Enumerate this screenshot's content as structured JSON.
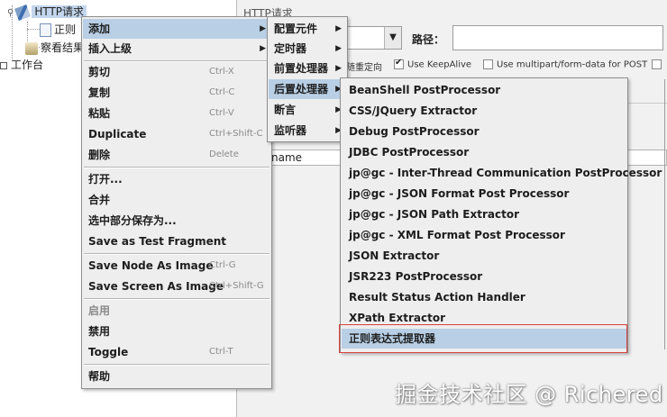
{
  "tree": {
    "http_request": "HTTP请求",
    "regex_node": "正则",
    "results_node": "察看结果",
    "workbench": "工作台"
  },
  "editor": {
    "title": "HTTP请求",
    "path_label": "路径：",
    "redirect_label": "随重定向",
    "keepalive_label": "Use KeepAlive",
    "multipart_label": "Use multipart/form-data for POST",
    "name_field": "name"
  },
  "main_menu": {
    "items": [
      {
        "label": "添加",
        "accel": "",
        "submenu": true
      },
      {
        "label": "插入上级",
        "accel": "",
        "submenu": true
      },
      {
        "label": "剪切",
        "accel": "Ctrl-X"
      },
      {
        "label": "复制",
        "accel": "Ctrl-C"
      },
      {
        "label": "粘贴",
        "accel": "Ctrl-V"
      },
      {
        "label": "Duplicate",
        "accel": "Ctrl+Shift-C"
      },
      {
        "label": "删除",
        "accel": "Delete"
      },
      {
        "label": "打开...",
        "accel": ""
      },
      {
        "label": "合并",
        "accel": ""
      },
      {
        "label": "选中部分保存为...",
        "accel": ""
      },
      {
        "label": "Save as Test Fragment",
        "accel": ""
      },
      {
        "label": "Save Node As Image",
        "accel": "Ctrl-G"
      },
      {
        "label": "Save Screen As Image",
        "accel": "Ctrl+Shift-G"
      },
      {
        "label": "启用",
        "accel": ""
      },
      {
        "label": "禁用",
        "accel": ""
      },
      {
        "label": "Toggle",
        "accel": "Ctrl-T"
      },
      {
        "label": "帮助",
        "accel": ""
      }
    ]
  },
  "add_menu": {
    "items": [
      "配置元件",
      "定时器",
      "前置处理器",
      "后置处理器",
      "断言",
      "监听器"
    ]
  },
  "post_menu": {
    "items": [
      "BeanShell PostProcessor",
      "CSS/JQuery Extractor",
      "Debug PostProcessor",
      "JDBC PostProcessor",
      "jp@gc - Inter-Thread Communication PostProcessor",
      "jp@gc - JSON Format Post Processor",
      "jp@gc - JSON Path Extractor",
      "jp@gc - XML Format Post Processor",
      "JSON Extractor",
      "JSR223 PostProcessor",
      "Result Status Action Handler",
      "XPath Extractor",
      "正则表达式提取器"
    ]
  },
  "colors": {
    "highlight": "#b8cfe5",
    "annotation_box": "#d94040"
  },
  "watermark": "掘金技术社区 @ Richered"
}
